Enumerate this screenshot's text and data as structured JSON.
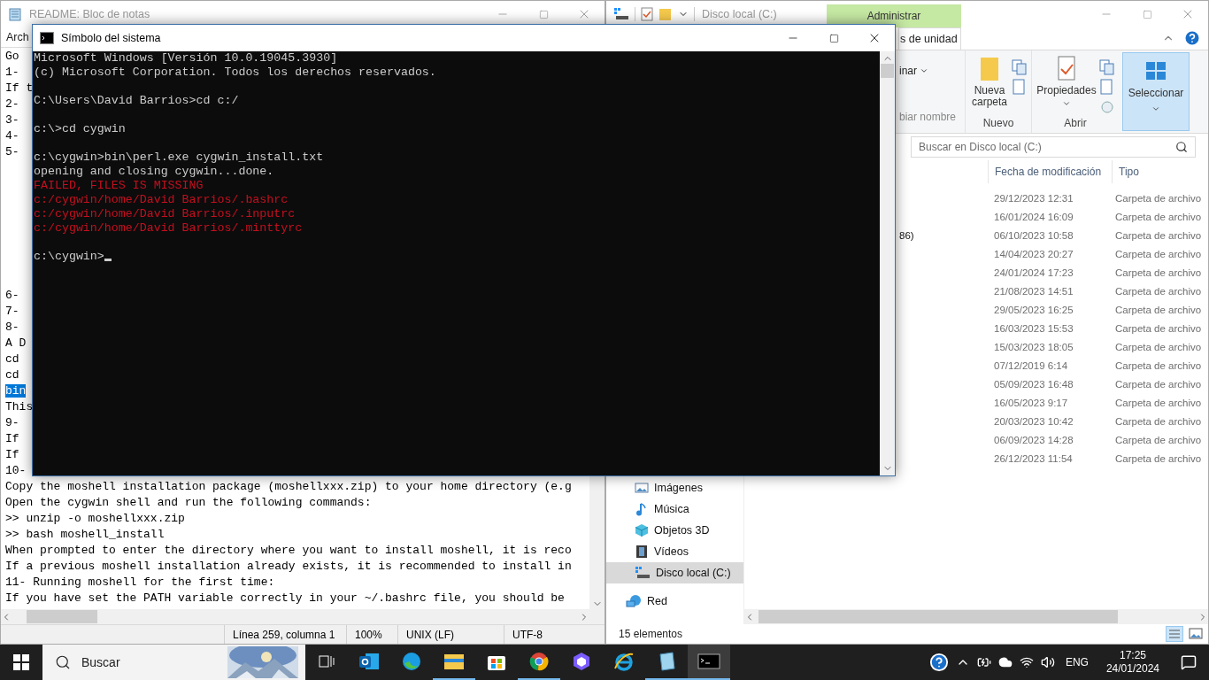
{
  "notepad": {
    "title": "README: Bloc de notas",
    "menu": [
      "Arch"
    ],
    "lines": [
      {
        "text": "Go",
        "selected": false
      },
      {
        "text": "1-",
        "selected": false
      },
      {
        "text": "If t",
        "selected": false
      },
      {
        "text": "2-",
        "selected": false
      },
      {
        "text": "3-",
        "selected": false
      },
      {
        "text": "4-",
        "selected": false
      },
      {
        "text": "5-",
        "selected": false
      },
      {
        "selected": false
      },
      {
        "selected": false
      },
      {
        "selected": false
      },
      {
        "selected": false
      },
      {
        "selected": false
      },
      {
        "selected": false
      },
      {
        "selected": false
      },
      {
        "selected": false
      },
      {
        "text": "6-",
        "selected": false
      },
      {
        "text": "7-",
        "selected": false
      },
      {
        "text": "8-",
        "selected": false
      },
      {
        "text": "A D",
        "selected": false
      },
      {
        "text": "cd",
        "selected": false
      },
      {
        "text": "cd",
        "selected": false
      },
      {
        "text": "bin",
        "selected": true
      },
      {
        "text": "This",
        "selected": false
      },
      {
        "text": "9-",
        "selected": false
      },
      {
        "text": "If",
        "selected": false
      },
      {
        "text": "If",
        "selected": false
      },
      {
        "text": "10-",
        "selected": false
      },
      {
        "text": "Copy the moshell installation package (moshellxxx.zip) to your home directory (e.g",
        "selected": false
      },
      {
        "text": "Open the cygwin shell and run the following commands:",
        "selected": false
      },
      {
        "text": ">> unzip -o moshellxxx.zip",
        "selected": false
      },
      {
        "text": ">> bash moshell_install",
        "selected": false
      },
      {
        "text": "When prompted to enter the directory where you want to install moshell, it is reco",
        "selected": false
      },
      {
        "text": "If a previous moshell installation already exists, it is recommended to install in",
        "selected": false
      },
      {
        "text": "11- Running moshell for the first time:",
        "selected": false
      },
      {
        "text": "If you have set the PATH variable correctly in your ~/.bashrc file, you should be",
        "selected": false
      }
    ],
    "status": [
      "Línea 259, columna 1",
      "100%",
      "UNIX (LF)",
      "UTF-8"
    ]
  },
  "explorer": {
    "title": "Disco local (C:)",
    "context_tab": "Administrar",
    "ribbon_tab": "s de unidad",
    "ribbon_partial": [
      "inar",
      "biar nombre"
    ],
    "groups": [
      {
        "label": "Nuevo",
        "button": "Nueva carpeta"
      },
      {
        "label": "Abrir",
        "button": "Propiedades"
      }
    ],
    "select_button": "Seleccionar",
    "search": {
      "placeholder": "Buscar en Disco local (C:)"
    },
    "columns": [
      "Fecha de modificación",
      "Tipo"
    ],
    "rows": [
      {
        "date": "29/12/2023 12:31",
        "type": "Carpeta de archivo"
      },
      {
        "date": "16/01/2024 16:09",
        "type": "Carpeta de archivo"
      },
      {
        "name": "86)",
        "date": "06/10/2023 10:58",
        "type": "Carpeta de archivo"
      },
      {
        "date": "14/04/2023 20:27",
        "type": "Carpeta de archivo"
      },
      {
        "date": "24/01/2024 17:23",
        "type": "Carpeta de archivo"
      },
      {
        "date": "21/08/2023 14:51",
        "type": "Carpeta de archivo"
      },
      {
        "date": "29/05/2023 16:25",
        "type": "Carpeta de archivo"
      },
      {
        "date": "16/03/2023 15:53",
        "type": "Carpeta de archivo"
      },
      {
        "date": "15/03/2023 18:05",
        "type": "Carpeta de archivo"
      },
      {
        "date": "07/12/2019 6:14",
        "type": "Carpeta de archivo"
      },
      {
        "date": "05/09/2023 16:48",
        "type": "Carpeta de archivo"
      },
      {
        "date": "16/05/2023 9:17",
        "type": "Carpeta de archivo"
      },
      {
        "date": "20/03/2023 10:42",
        "type": "Carpeta de archivo"
      },
      {
        "date": "06/09/2023 14:28",
        "type": "Carpeta de archivo"
      },
      {
        "date": "26/12/2023 11:54",
        "type": "Carpeta de archivo"
      }
    ],
    "nav": [
      {
        "label": "Imágenes",
        "kind": "pictures",
        "selected": false
      },
      {
        "label": "Música",
        "kind": "music",
        "selected": false
      },
      {
        "label": "Objetos 3D",
        "kind": "objects",
        "selected": false
      },
      {
        "label": "Vídeos",
        "kind": "videos",
        "selected": false
      },
      {
        "label": "Disco local (C:)",
        "kind": "drive",
        "selected": true
      },
      {
        "label": "Red",
        "kind": "network",
        "selected": false
      }
    ],
    "status": "15 elementos"
  },
  "cmd": {
    "title": "Símbolo del sistema",
    "lines": [
      {
        "text": "Microsoft Windows [Versión 10.0.19045.3930]",
        "kind": "output"
      },
      {
        "text": "(c) Microsoft Corporation. Todos los derechos reservados.",
        "kind": "output"
      },
      {
        "kind": "blank"
      },
      {
        "text": "C:\\Users\\David Barrios>cd c:/",
        "kind": "output"
      },
      {
        "kind": "blank"
      },
      {
        "text": "c:\\>cd cygwin",
        "kind": "output"
      },
      {
        "kind": "blank"
      },
      {
        "text": "c:\\cygwin>bin\\perl.exe cygwin_install.txt",
        "kind": "output"
      },
      {
        "text": "opening and closing cygwin...done.",
        "kind": "output"
      },
      {
        "text": "FAILED, FILES IS MISSING",
        "kind": "error"
      },
      {
        "text": "c:/cygwin/home/David Barrios/.bashrc",
        "kind": "error"
      },
      {
        "text": "c:/cygwin/home/David Barrios/.inputrc",
        "kind": "error"
      },
      {
        "text": "c:/cygwin/home/David Barrios/.minttyrc",
        "kind": "error"
      },
      {
        "kind": "blank"
      },
      {
        "text": "c:\\cygwin>",
        "kind": "prompt"
      }
    ]
  },
  "taskbar": {
    "search_placeholder": "Buscar",
    "apps": [
      {
        "kind": "taskview",
        "open": false,
        "selected": false
      },
      {
        "kind": "outlook",
        "open": false,
        "selected": false
      },
      {
        "kind": "edge",
        "open": false,
        "selected": false
      },
      {
        "kind": "files",
        "open": true,
        "selected": false
      },
      {
        "kind": "store",
        "open": false,
        "selected": false
      },
      {
        "kind": "chrome",
        "open": true,
        "selected": false
      },
      {
        "kind": "copilot",
        "open": false,
        "selected": false
      },
      {
        "kind": "ie",
        "open": false,
        "selected": false
      },
      {
        "kind": "notes",
        "open": true,
        "selected": false
      },
      {
        "kind": "terminal",
        "open": true,
        "selected": true
      }
    ],
    "language": "ENG",
    "time": "17:25",
    "date": "24/01/2024"
  }
}
